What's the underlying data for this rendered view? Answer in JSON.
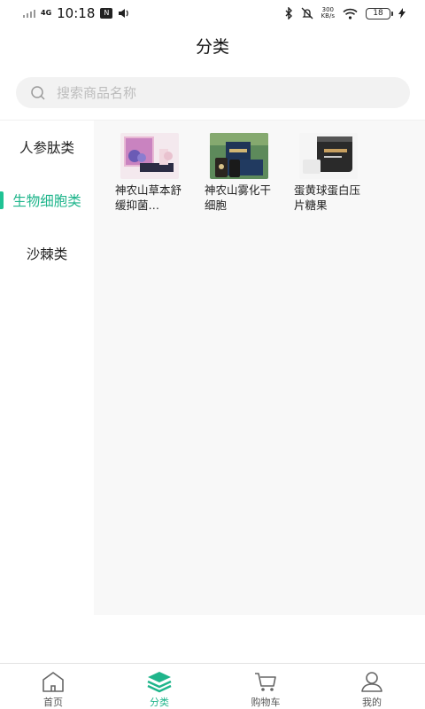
{
  "status_bar": {
    "network": "4G",
    "time": "10:18",
    "box_icon_label": "N",
    "speed_value": "300",
    "speed_unit": "KB/s",
    "battery": "18"
  },
  "header": {
    "title": "分类"
  },
  "search": {
    "placeholder": "搜索商品名称"
  },
  "sidebar": {
    "items": [
      {
        "label": "人参肽类"
      },
      {
        "label": "生物细胞类",
        "active": true
      },
      {
        "label": "沙棘类"
      }
    ]
  },
  "products": [
    {
      "name": "神农山草本舒缓抑菌…",
      "image": "purple-product-box-image"
    },
    {
      "name": "神农山雾化干细胞",
      "image": "blue-gift-set-image"
    },
    {
      "name": "蛋黄球蛋白压片糖果",
      "image": "black-bottle-image"
    }
  ],
  "tabbar": {
    "items": [
      {
        "label": "首页",
        "icon": "home-icon"
      },
      {
        "label": "分类",
        "icon": "layers-icon",
        "active": true
      },
      {
        "label": "购物车",
        "icon": "cart-icon"
      },
      {
        "label": "我的",
        "icon": "user-icon"
      }
    ]
  },
  "colors": {
    "accent": "#1fb58b",
    "content_bg": "#f8f8f8",
    "search_bg": "#f2f2f2"
  }
}
